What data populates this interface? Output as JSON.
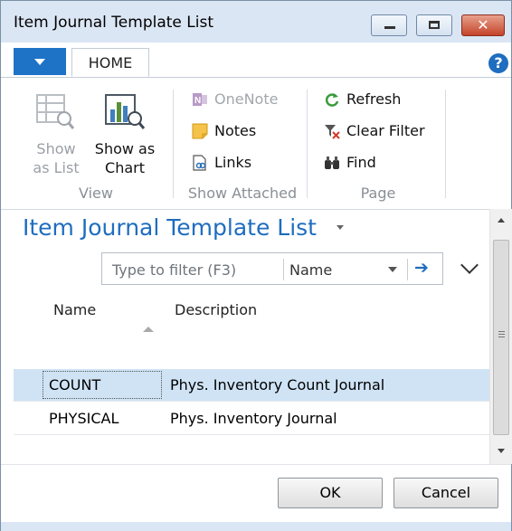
{
  "window": {
    "title": "Item Journal Template List",
    "minimize_icon": "minimize-icon",
    "maximize_icon": "maximize-icon",
    "close_icon": "close-icon",
    "close_glyph": "✕"
  },
  "ribbon": {
    "tab_home": "HOME",
    "help_glyph": "?",
    "groups": {
      "view": {
        "label": "View",
        "show_as_list": [
          "Show",
          "as List"
        ],
        "show_as_chart": [
          "Show as",
          "Chart"
        ]
      },
      "show_attached": {
        "label": "Show Attached",
        "onenote": "OneNote",
        "notes": "Notes",
        "links": "Links"
      },
      "page": {
        "label": "Page",
        "refresh": "Refresh",
        "clear_filter": "Clear Filter",
        "find": "Find"
      }
    }
  },
  "list": {
    "title": "Item Journal Template List",
    "filter": {
      "placeholder": "Type to filter (F3)",
      "field": "Name",
      "apply_glyph": "➔"
    },
    "columns": [
      "Name",
      "Description"
    ],
    "rows": [
      {
        "name": "COUNT",
        "description": "Phys. Inventory Count Journal",
        "selected": true
      },
      {
        "name": "PHYSICAL",
        "description": "Phys. Inventory Journal",
        "selected": false
      }
    ]
  },
  "footer": {
    "ok": "OK",
    "cancel": "Cancel"
  },
  "colors": {
    "accent": "#1e6dbf",
    "selected_row": "#cfe3f5",
    "titlebar": "#dbe6f4"
  }
}
